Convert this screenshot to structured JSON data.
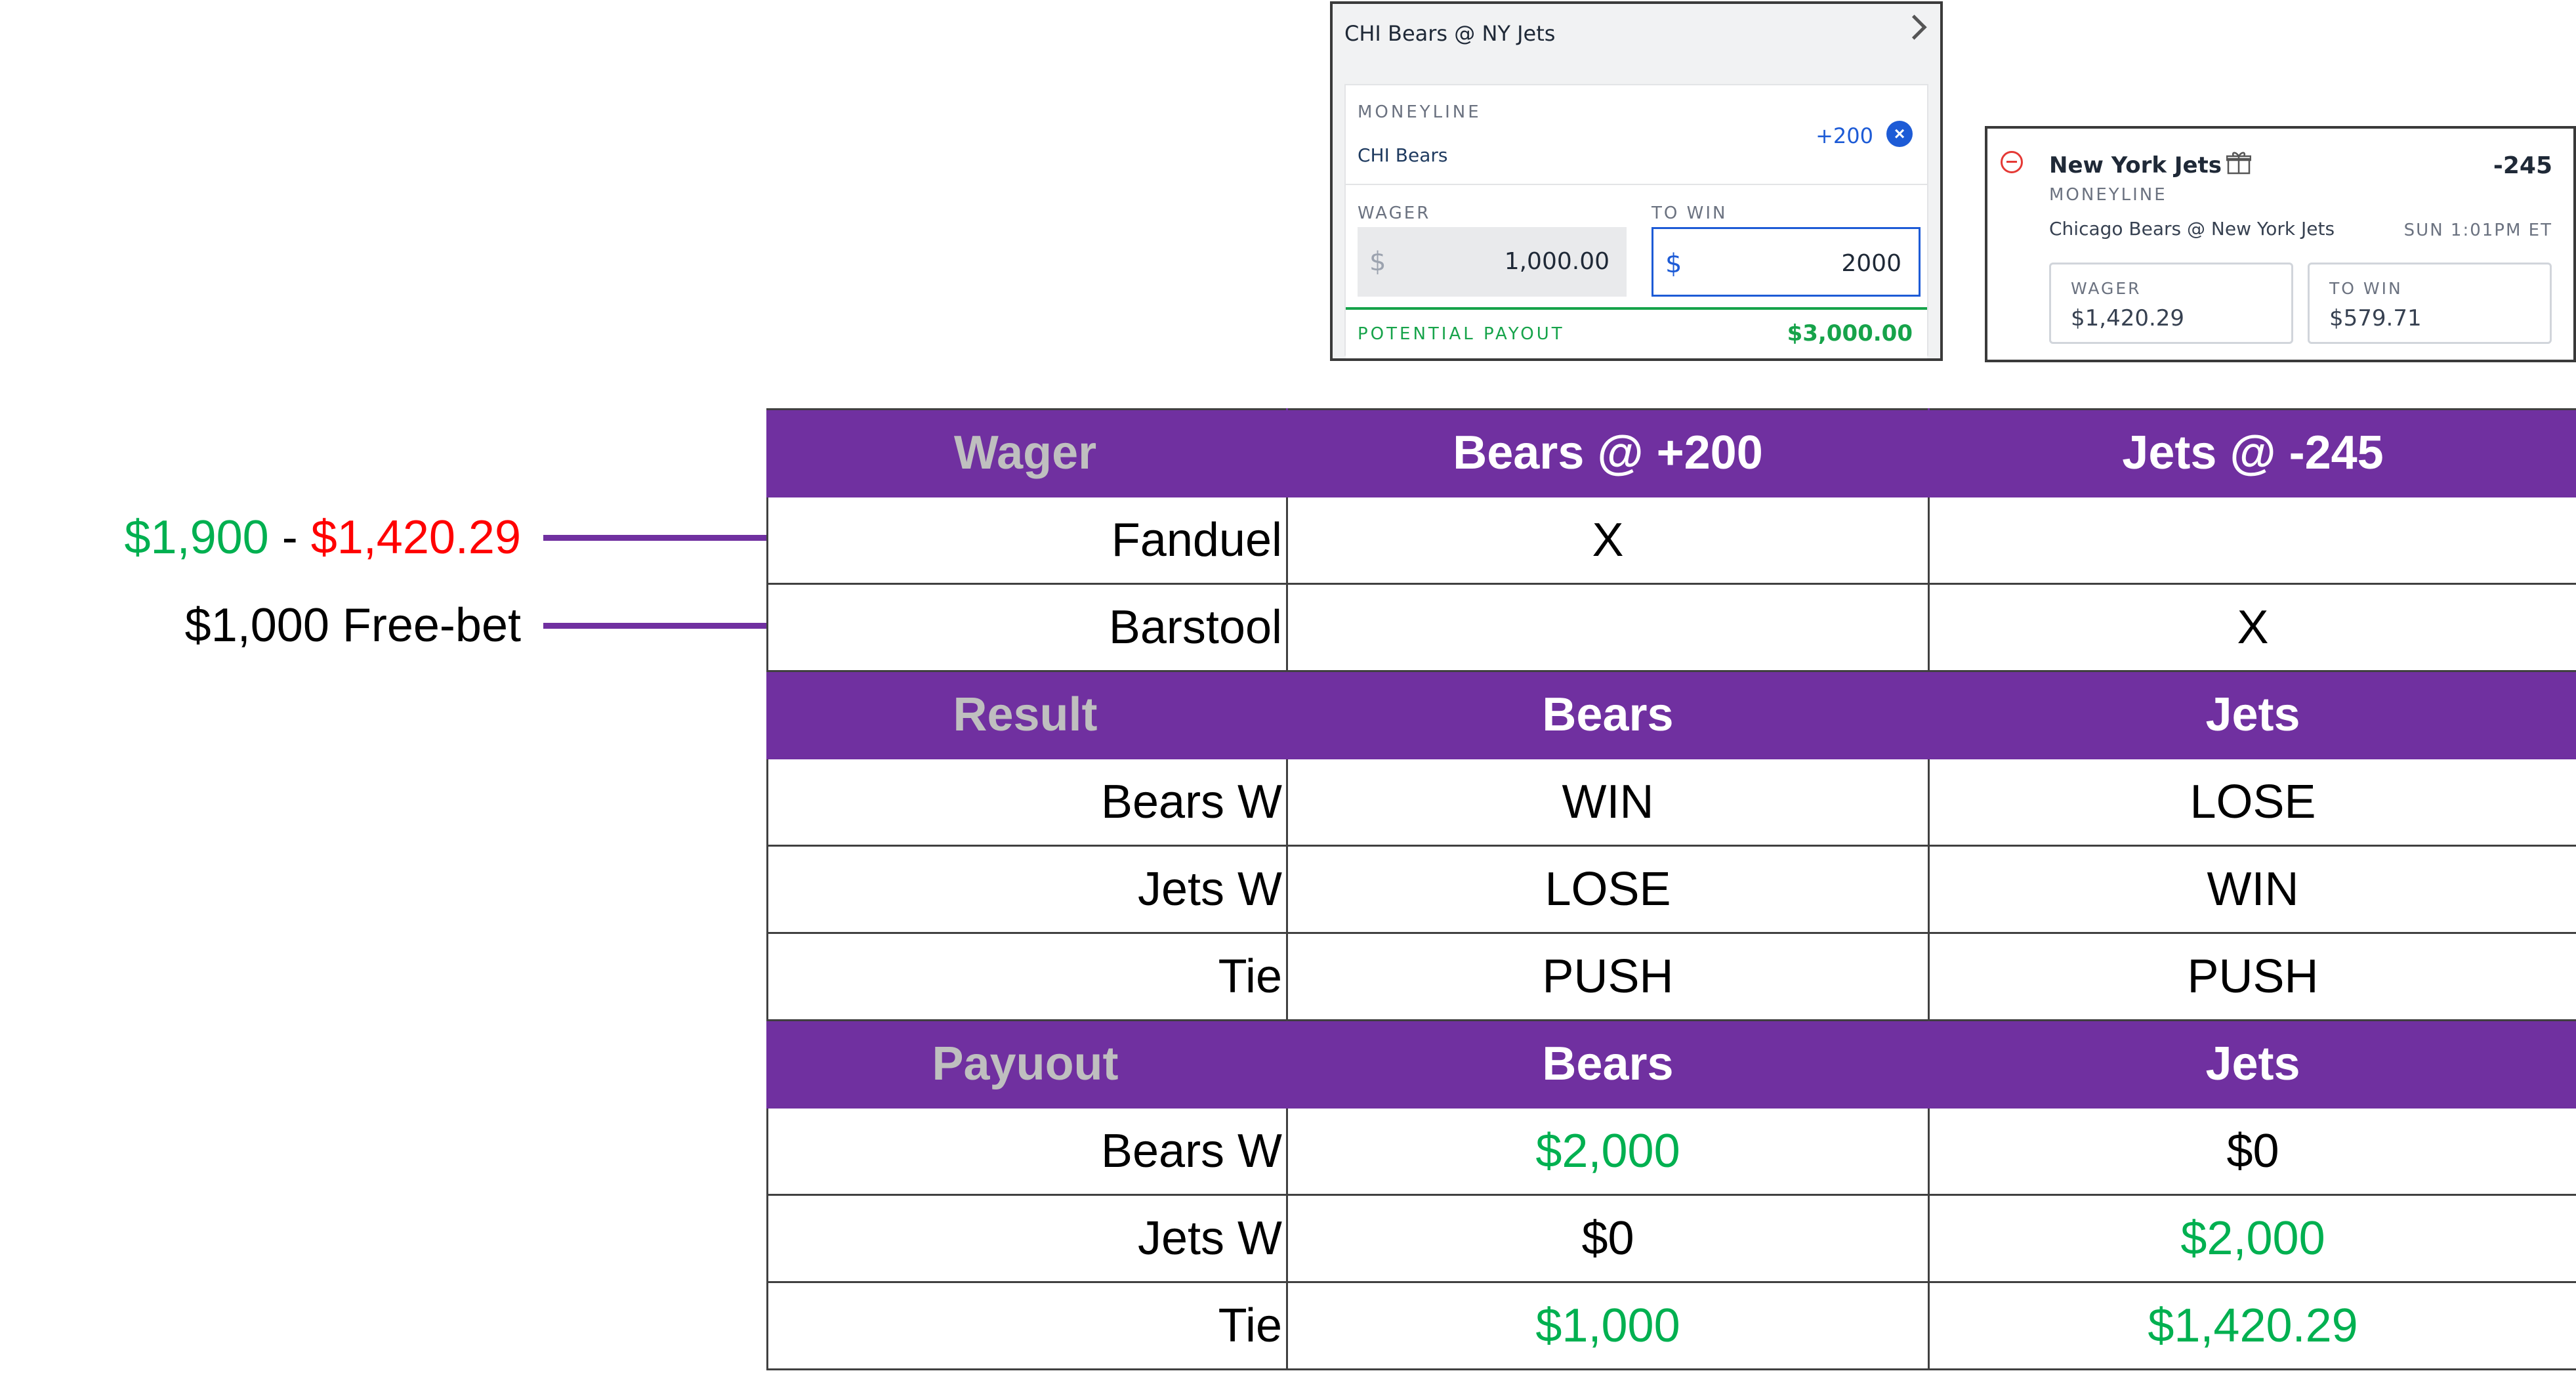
{
  "fanduel_slip": {
    "title": "CHI Bears @ NY Jets",
    "market_label": "MONEYLINE",
    "team": "CHI Bears",
    "odds": "+200",
    "wager_label": "WAGER",
    "wager_currency": "$",
    "wager_value": "1,000.00",
    "to_win_label": "TO WIN",
    "to_win_currency": "$",
    "to_win_value": "2000",
    "payout_label": "POTENTIAL PAYOUT",
    "payout_value": "$3,000.00"
  },
  "barstool_slip": {
    "team": "New York Jets",
    "odds": "-245",
    "market_label": "MONEYLINE",
    "matchup": "Chicago Bears @ New York Jets",
    "game_time": "SUN 1:01PM ET",
    "wager_label": "WAGER",
    "wager_value": "$1,420.29",
    "to_win_label": "TO WIN",
    "to_win_value": "$579.71"
  },
  "annotations": {
    "fanduel_amount_a": "$1,900",
    "fanduel_separator": " - ",
    "fanduel_amount_b": "$1,420.29",
    "barstool_amount": "$1,000 Free-bet"
  },
  "table": {
    "wager_header": [
      "Wager",
      "Bears @ +200",
      "Jets @ -245"
    ],
    "wager_rows": [
      [
        "Fanduel",
        "X",
        ""
      ],
      [
        "Barstool",
        "",
        "X"
      ]
    ],
    "result_header": [
      "Result",
      "Bears",
      "Jets"
    ],
    "result_rows": [
      [
        "Bears W",
        "WIN",
        "LOSE"
      ],
      [
        "Jets W",
        "LOSE",
        "WIN"
      ],
      [
        "Tie",
        "PUSH",
        "PUSH"
      ]
    ],
    "payout_header": [
      "Payuout",
      "Bears",
      "Jets"
    ],
    "payout_rows": [
      [
        "Bears W",
        "$2,000",
        "$0"
      ],
      [
        "Jets W",
        "$0",
        "$2,000"
      ],
      [
        "Tie",
        "$1,000",
        "$1,420.29"
      ]
    ]
  },
  "colors": {
    "header_purple": "#7030a0",
    "profit_green": "#00b050",
    "loss_red": "#ff0000",
    "fanduel_blue": "#1d5bd6"
  }
}
